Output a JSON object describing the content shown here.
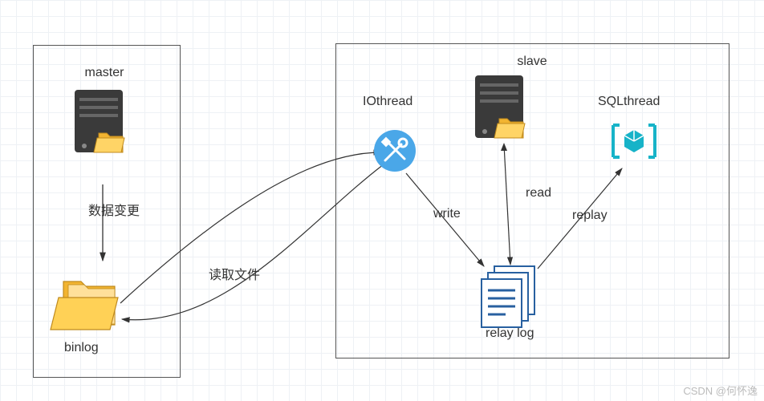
{
  "diagram": {
    "master": {
      "title": "master",
      "binlog": "binlog",
      "edge_data_change": "数据变更"
    },
    "slave": {
      "title": "slave",
      "iothread": "IOthread",
      "sqlthread": "SQLthread",
      "relaylog": "relay log",
      "edge_write": "write",
      "edge_read": "read",
      "edge_replay": "replay"
    },
    "edge_read_file": "读取文件"
  },
  "watermark": "CSDN @何怀逸"
}
